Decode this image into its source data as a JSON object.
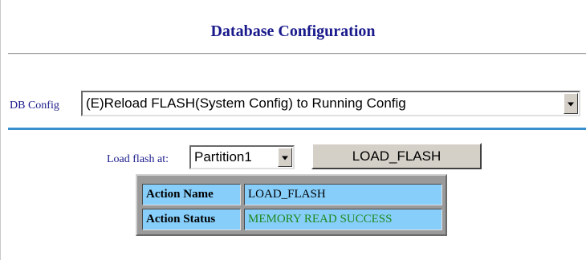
{
  "header": {
    "title": "Database Configuration"
  },
  "db_config": {
    "label": "DB Config",
    "selected": "(E)Reload FLASH(System Config) to Running Config"
  },
  "load_flash": {
    "label": "Load flash at:",
    "partition_selected": "Partition1",
    "button_label": "LOAD_FLASH"
  },
  "status_table": {
    "rows": [
      {
        "label": "Action Name",
        "value": "LOAD_FLASH",
        "color": "#000000"
      },
      {
        "label": "Action Status",
        "value": "MEMORY READ SUCCESS",
        "color": "#1e8a1e"
      }
    ]
  }
}
